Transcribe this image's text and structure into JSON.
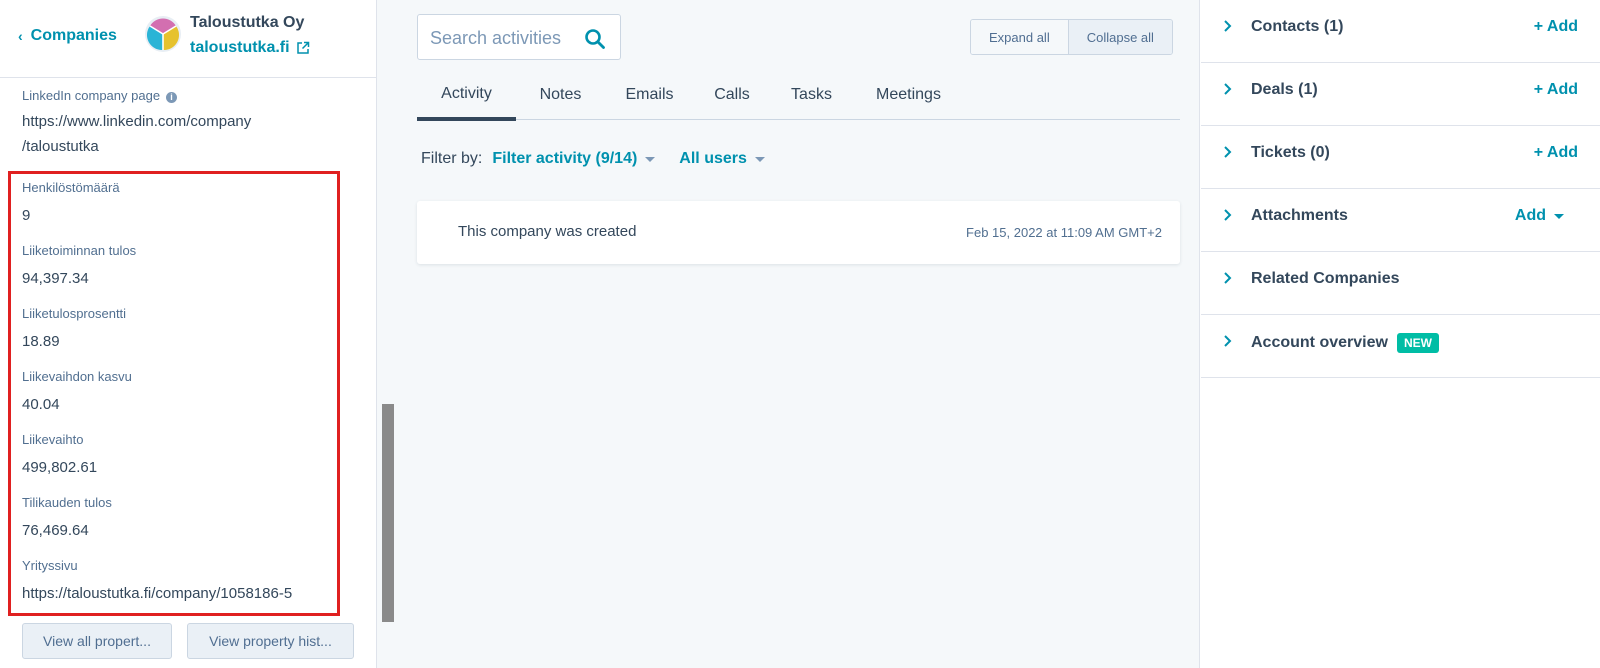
{
  "header": {
    "back_label": "Companies",
    "company_name": "Taloustutka Oy",
    "company_domain": "taloustutka.fi"
  },
  "linkedin": {
    "label": "LinkedIn company page",
    "value_line1": "https://www.linkedin.com/company",
    "value_line2": "/taloustutka"
  },
  "properties": [
    {
      "label": "Henkilöstömäärä",
      "value": "9"
    },
    {
      "label": "Liiketoiminnan tulos",
      "value": "94,397.34"
    },
    {
      "label": "Liiketulosprosentti",
      "value": "18.89"
    },
    {
      "label": "Liikevaihdon kasvu",
      "value": "40.04"
    },
    {
      "label": "Liikevaihto",
      "value": "499,802.61"
    },
    {
      "label": "Tilikauden tulos",
      "value": "76,469.64"
    },
    {
      "label": "Yrityssivu",
      "value": "https://taloustutka.fi/company/1058186-5"
    }
  ],
  "left_buttons": {
    "view_all": "View all propert...",
    "view_history": "View property hist..."
  },
  "search": {
    "placeholder": "Search activities"
  },
  "toolbar": {
    "expand_all": "Expand all",
    "collapse_all": "Collapse all"
  },
  "tabs": [
    "Activity",
    "Notes",
    "Emails",
    "Calls",
    "Tasks",
    "Meetings"
  ],
  "filter": {
    "label": "Filter by:",
    "activity": "Filter activity (9/14)",
    "users": "All users"
  },
  "activity": {
    "text": "This company was created",
    "time": "Feb 15, 2022 at 11:09 AM GMT+2"
  },
  "sidebar_cards": [
    {
      "title": "Contacts (1)",
      "action": "+ Add"
    },
    {
      "title": "Deals (1)",
      "action": "+ Add"
    },
    {
      "title": "Tickets (0)",
      "action": "+ Add"
    },
    {
      "title": "Attachments",
      "action": "Add"
    },
    {
      "title": "Related Companies",
      "action": ""
    },
    {
      "title": "Account overview",
      "action": "",
      "badge": "NEW"
    }
  ],
  "colors": {
    "accent": "#0091ae",
    "text": "#33475b",
    "highlight": "#e02020",
    "badge_new": "#00bda5"
  }
}
